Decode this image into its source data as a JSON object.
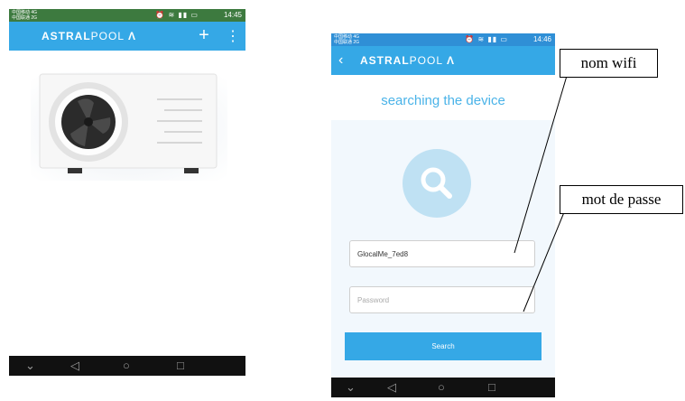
{
  "phone_left": {
    "status": {
      "carrier": "中国移动 4G\n中国联通 2G",
      "icons": "⏰ ≋ ▮▮ ▭",
      "time": "14:45"
    },
    "brand": {
      "bold": "ASTRAL",
      "light": "POOL",
      "logo": "Λ"
    },
    "add_icon": "+",
    "menu_icon": "⋮",
    "nav": {
      "back": "◁",
      "home": "○",
      "recent": "□",
      "down": "⌄"
    }
  },
  "phone_right": {
    "status": {
      "carrier": "中国移动 4G\n中国联通 2G",
      "icons": "⏰ ≋ ▮▮ ▭",
      "time": "14:46"
    },
    "brand": {
      "bold": "ASTRAL",
      "light": "POOL",
      "logo": "Λ"
    },
    "back_icon": "‹",
    "title": "searching the device",
    "wifi_value": "GlocalMe_7ed8",
    "password_placeholder": "Password",
    "search_label": "Search",
    "nav": {
      "back": "◁",
      "home": "○",
      "recent": "□",
      "down": "⌄"
    }
  },
  "callouts": {
    "wifi": "nom wifi",
    "password": "mot de passe"
  },
  "colors": {
    "accent": "#35a8e6",
    "title": "#4ab3e8"
  }
}
